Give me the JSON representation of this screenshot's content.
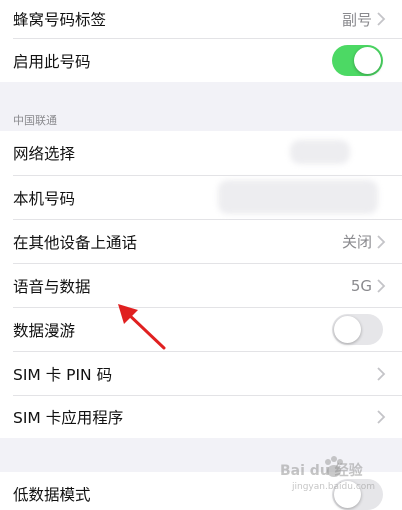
{
  "top_group": {
    "honeycomb_label": "蜂窝号码标签",
    "honeycomb_value": "副号",
    "enable_label": "启用此号码",
    "enable_state": "on"
  },
  "carrier_section": {
    "header": "中国联通",
    "rows": [
      {
        "label": "网络选择"
      },
      {
        "label": "本机号码"
      },
      {
        "label": "在其他设备上通话",
        "value": "关闭"
      },
      {
        "label": "语音与数据",
        "value": "5G"
      },
      {
        "label": "数据漫游",
        "toggle": "off"
      },
      {
        "label": "SIM 卡 PIN 码"
      },
      {
        "label": "SIM 卡应用程序"
      }
    ]
  },
  "bottom_group": {
    "low_data_label": "低数据模式",
    "low_data_state": "off"
  },
  "watermark": {
    "brand": "Bai du 经验",
    "url": "jingyan.baidu.com"
  },
  "colors": {
    "toggle_on": "#4cd964",
    "annotation_arrow": "#e02020",
    "background": "#f2f2f7"
  }
}
